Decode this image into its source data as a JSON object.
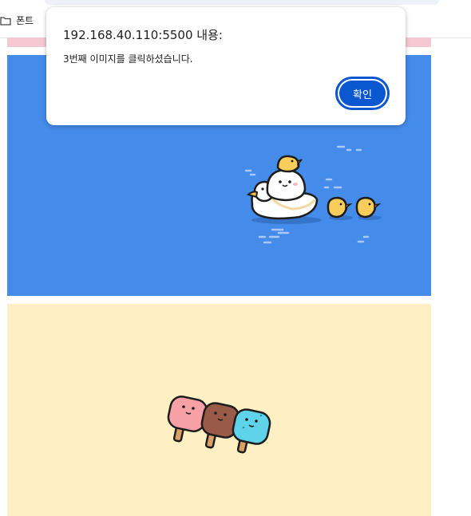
{
  "bookmarks": {
    "folder_label": "폰트",
    "folder_icon": "folder-icon"
  },
  "gallery": {
    "image3": {
      "background": "#448bea",
      "subject": "white duck with chicks on water"
    },
    "image4": {
      "background": "#fef0c2",
      "subject": "three ice pops"
    },
    "strip_color": "#f6c9d2"
  },
  "dialog": {
    "title": "192.168.40.110:5500 내용:",
    "message": "3번째 이미지를 클릭하셨습니다.",
    "ok_label": "확인",
    "accent": "#0b57d0"
  }
}
